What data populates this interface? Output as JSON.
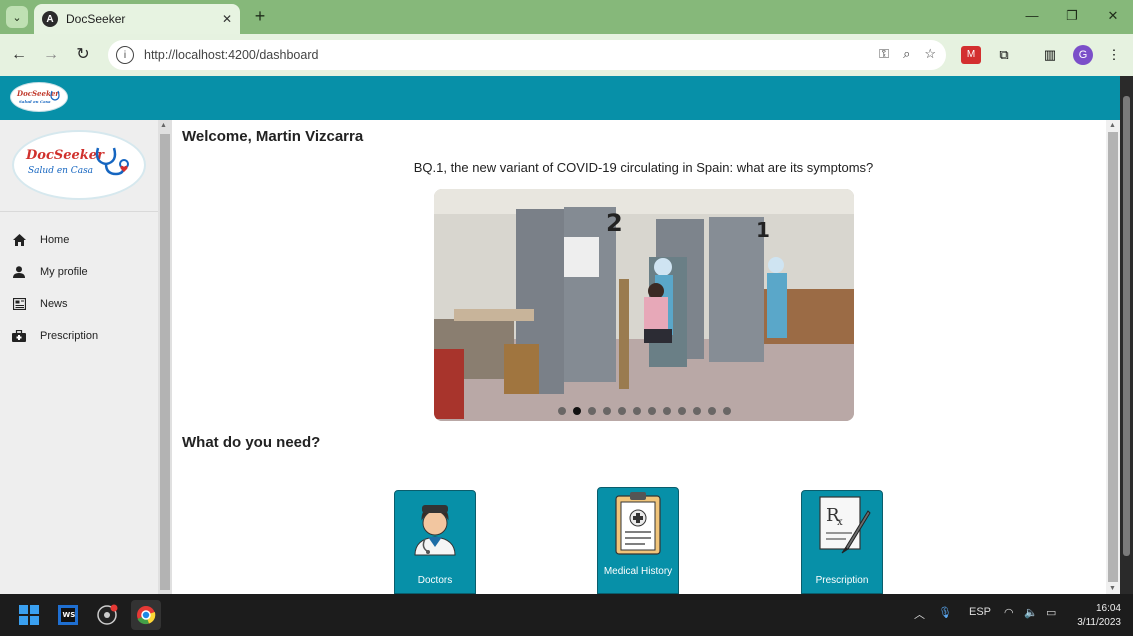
{
  "browser": {
    "tab_title": "DocSeeker",
    "url": "http://localhost:4200/dashboard",
    "new_tab_symbol": "+",
    "profile_initial": "G"
  },
  "sidebar": {
    "logo_title": "DocSeeker",
    "logo_subtitle": "Salud en Casa",
    "items": [
      {
        "label": "Home",
        "icon": "home-icon"
      },
      {
        "label": "My profile",
        "icon": "person-icon"
      },
      {
        "label": "News",
        "icon": "news-icon"
      },
      {
        "label": "Prescription",
        "icon": "briefcase-medical-icon"
      }
    ]
  },
  "main": {
    "welcome": "Welcome, Martin Vizcarra",
    "news_title": "BQ.1, the new variant of COVID-19 circulating in Spain: what are its symptoms?",
    "carousel": {
      "slide_count": 12,
      "active_index": 1
    },
    "need_heading": "What do you need?",
    "cards": [
      {
        "label": "Doctors",
        "icon": "doctor-icon"
      },
      {
        "label": "Medical History",
        "icon": "clipboard-icon"
      },
      {
        "label": "Prescription",
        "icon": "prescription-icon"
      }
    ]
  },
  "taskbar": {
    "language": "ESP",
    "time": "16:04",
    "date": "3/11/2023"
  },
  "colors": {
    "app_header": "#0790a8",
    "browser_frame": "#86b87a",
    "card": "#0790a8"
  }
}
